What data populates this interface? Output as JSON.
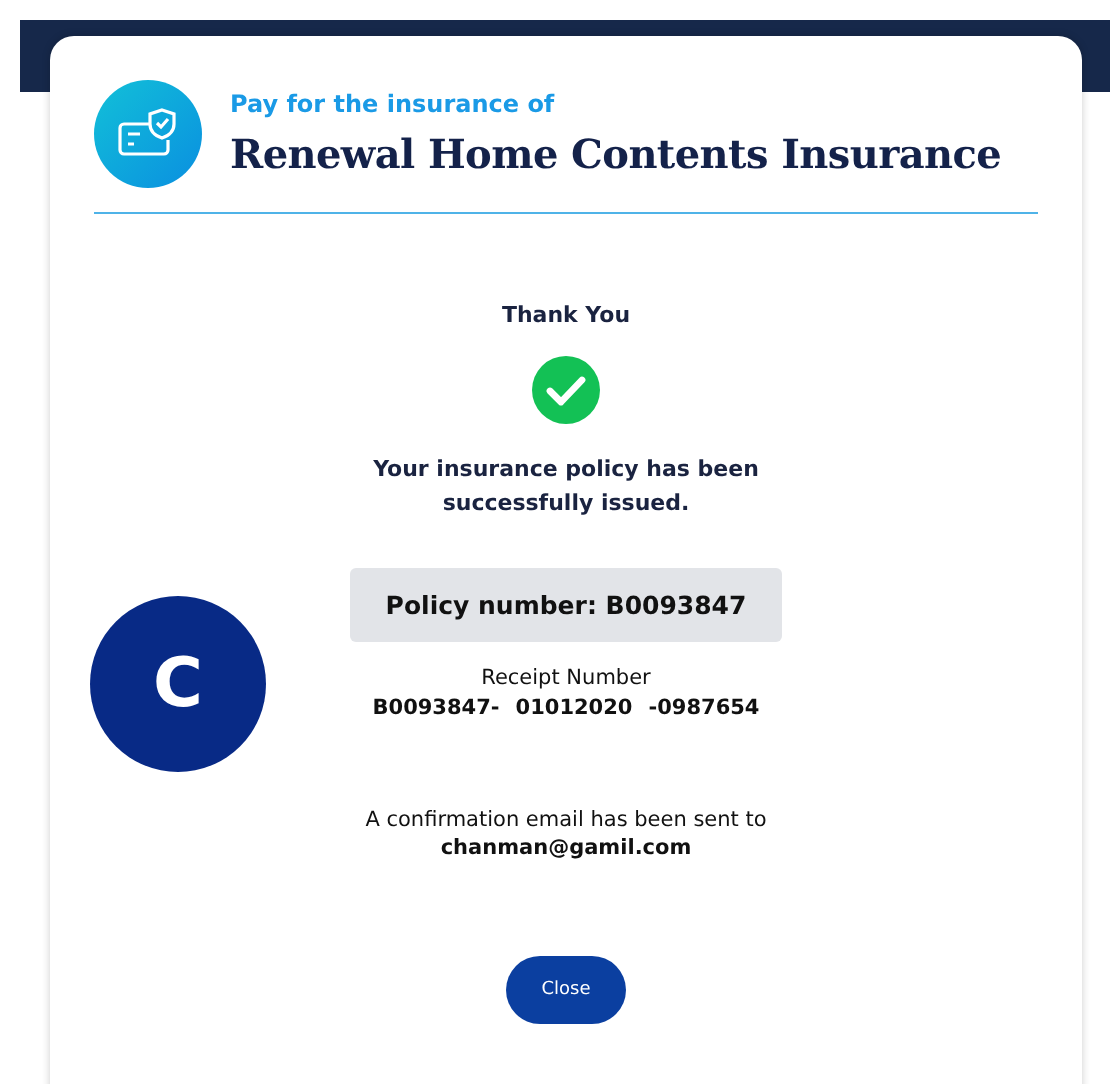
{
  "header": {
    "subtitle": "Pay for the insurance of",
    "title": "Renewal Home Contents Insurance"
  },
  "confirmation": {
    "heading": "Thank You",
    "message": "Your insurance policy has been successfully issued.",
    "policy_number": "Policy number: B0093847",
    "receipt_label": "Receipt Number",
    "receipt_parts": [
      "B0093847-",
      "01012020",
      "-0987654"
    ],
    "email_note": "A confirmation email has been sent to",
    "email": "chanman@gamil.com"
  },
  "avatar": {
    "initial": "C"
  },
  "buttons": [
    "Close"
  ]
}
